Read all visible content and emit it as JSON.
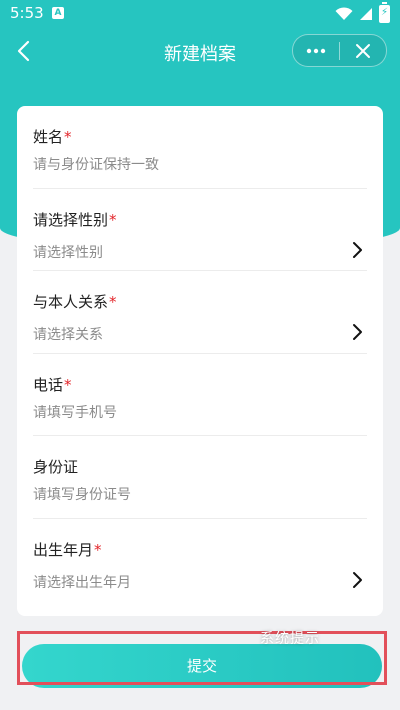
{
  "status_bar": {
    "time": "5:53",
    "notification_letter": "A"
  },
  "nav": {
    "title": "新建档案"
  },
  "form": {
    "fields": [
      {
        "label": "姓名",
        "required": "*",
        "placeholder": "请与身份证保持一致",
        "type": "input"
      },
      {
        "label": "请选择性别",
        "required": "*",
        "value": "请选择性别",
        "type": "select"
      },
      {
        "label": "与本人关系",
        "required": "*",
        "value": "请选择关系",
        "type": "select"
      },
      {
        "label": "电话",
        "required": "*",
        "placeholder": "请填写手机号",
        "type": "input"
      },
      {
        "label": "身份证",
        "required": "",
        "placeholder": "请填写身份证号",
        "type": "input"
      },
      {
        "label": "出生年月",
        "required": "*",
        "value": "请选择出生年月",
        "type": "select"
      }
    ]
  },
  "submit": {
    "label": "提交"
  },
  "overlay": {
    "text": "系统提示"
  },
  "colors": {
    "accent": "#26c5c0",
    "required": "#e3262b",
    "highlight": "#e2505a"
  },
  "icons": [
    "back-arrow-icon",
    "more-dots-icon",
    "close-icon",
    "chevron-right-icon",
    "wifi-icon",
    "signal-icon",
    "battery-icon"
  ]
}
